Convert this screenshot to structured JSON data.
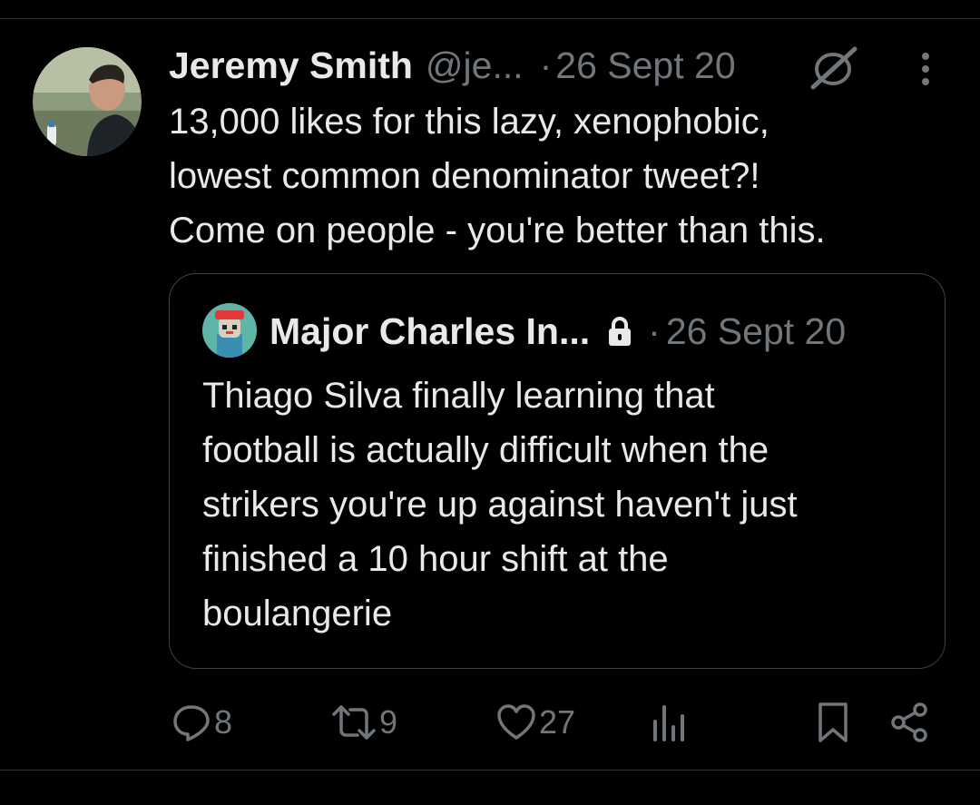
{
  "tweet": {
    "display_name": "Jeremy Smith",
    "handle": "@je...",
    "separator": "·",
    "date": "26 Sept 20",
    "text_lines": [
      "13,000 likes for this lazy, xenophobic,",
      "lowest common denominator tweet?!",
      "Come on people - you're better than this."
    ]
  },
  "quoted": {
    "display_name": "Major Charles In...",
    "separator": "·",
    "date": "26 Sept 20",
    "text_lines": [
      "Thiago Silva finally learning that",
      "football is actually difficult when the",
      "strikers you're up against haven't just",
      "finished a 10 hour shift at the",
      "boulangerie"
    ]
  },
  "actions": {
    "replies": "8",
    "retweets": "9",
    "likes": "27"
  },
  "icons": [
    "grok-icon",
    "more-icon",
    "lock-icon",
    "reply-icon",
    "retweet-icon",
    "like-icon",
    "views-icon",
    "bookmark-icon",
    "share-icon"
  ],
  "colors": {
    "background": "#000000",
    "text": "#e7e9ea",
    "secondary": "#71767b",
    "border": "#2f3336"
  }
}
